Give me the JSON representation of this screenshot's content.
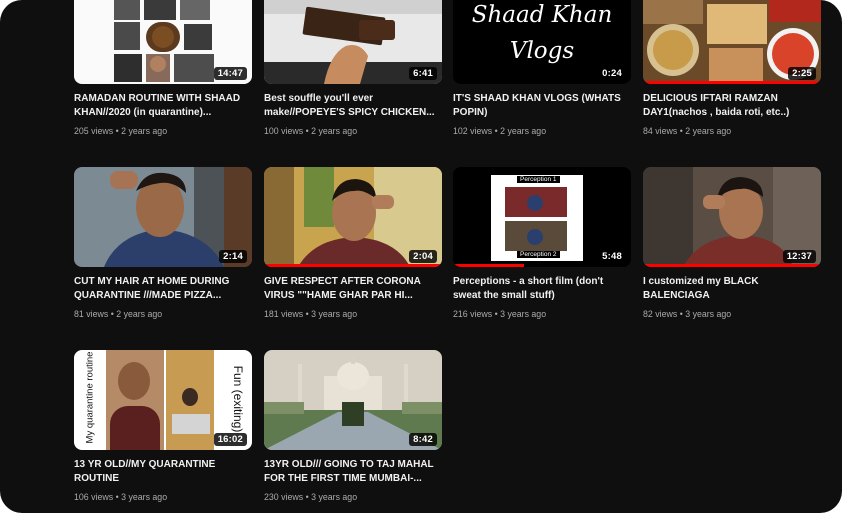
{
  "videos": [
    {
      "title_line1": "RAMADAN ROUTINE WITH SHAAD",
      "title_line2": "KHAN//2020 (in quarantine)...",
      "views": "205 views",
      "age": "2 years ago",
      "duration": "14:47"
    },
    {
      "title_line1": "Best souffle you'll ever",
      "title_line2": "make//POPEYE'S SPICY CHICKEN...",
      "views": "100 views",
      "age": "2 years ago",
      "duration": "6:41"
    },
    {
      "title_line1": "IT'S SHAAD KHAN VLOGS (WHATS",
      "title_line2": "POPIN)",
      "views": "102 views",
      "age": "2 years ago",
      "duration": "0:24",
      "thumb_text_1": "Shaad Khan",
      "thumb_text_2": "Vlogs"
    },
    {
      "title_line1": "DELICIOUS IFTARI RAMZAN",
      "title_line2": "DAY1(nachos , baida roti, etc..)",
      "views": "84 views",
      "age": "2 years ago",
      "duration": "2:25"
    },
    {
      "title_line1": "CUT MY HAIR AT HOME DURING",
      "title_line2": "QUARANTINE ///MADE PIZZA...",
      "views": "81 views",
      "age": "2 years ago",
      "duration": "2:14"
    },
    {
      "title_line1": "GIVE RESPECT AFTER CORONA",
      "title_line2": "VIRUS \"\"HAME GHAR PAR HI...",
      "views": "181 views",
      "age": "3 years ago",
      "duration": "2:04"
    },
    {
      "title_line1": "Perceptions - a short film (don't",
      "title_line2": "sweat the small stuff)",
      "views": "216 views",
      "age": "3 years ago",
      "duration": "5:48",
      "thumb_text_1": "Perception 1",
      "thumb_text_2": "Perception 2"
    },
    {
      "title_line1": "I customized my BLACK",
      "title_line2": "BALENCIAGA",
      "views": "82 views",
      "age": "3 years ago",
      "duration": "12:37"
    },
    {
      "title_line1": "13 YR OLD//MY QUARANTINE",
      "title_line2": "ROUTINE",
      "views": "106 views",
      "age": "3 years ago",
      "duration": "16:02",
      "thumb_text_1": "My quarantine routine",
      "thumb_text_2": "Fun (exiting)"
    },
    {
      "title_line1": "13YR OLD/// GOING TO TAJ MAHAL",
      "title_line2": "FOR THE FIRST TIME MUMBAI-...",
      "views": "230 views",
      "age": "3 years ago",
      "duration": "8:42"
    }
  ],
  "meta_separator": "•",
  "progress": [
    0,
    0,
    0,
    1,
    0,
    1,
    0.4,
    1,
    0,
    0
  ],
  "colors": {
    "background": "#0f0f0f",
    "progress": "#ff0000",
    "title": "#f1f1f1",
    "meta": "#aaaaaa"
  }
}
